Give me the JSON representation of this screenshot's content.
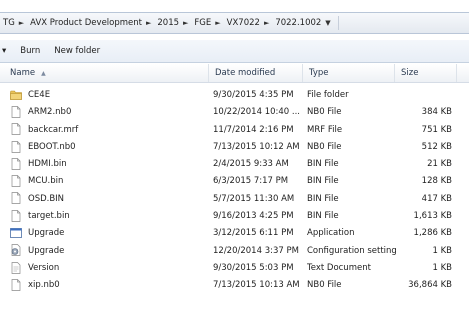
{
  "address": {
    "crumbs": [
      "TG",
      "AVX Product Development",
      "2015",
      "FGE",
      "VX7022",
      "7022.1002"
    ]
  },
  "toolbar": {
    "burn_label": "Burn",
    "new_folder_label": "New folder"
  },
  "columns": {
    "name": "Name",
    "date": "Date modified",
    "type": "Type",
    "size": "Size"
  },
  "files": [
    {
      "name": "CE4E",
      "date": "9/30/2015 4:35 PM",
      "type": "File folder",
      "size": "",
      "icon": "folder-icon"
    },
    {
      "name": "ARM2.nb0",
      "date": "10/22/2014 10:40 ...",
      "type": "NB0 File",
      "size": "384 KB",
      "icon": "file-icon"
    },
    {
      "name": "backcar.mrf",
      "date": "11/7/2014 2:16 PM",
      "type": "MRF File",
      "size": "751 KB",
      "icon": "file-icon"
    },
    {
      "name": "EBOOT.nb0",
      "date": "7/13/2015 10:12 AM",
      "type": "NB0 File",
      "size": "512 KB",
      "icon": "file-icon"
    },
    {
      "name": "HDMI.bin",
      "date": "2/4/2015 9:33 AM",
      "type": "BIN File",
      "size": "21 KB",
      "icon": "file-icon"
    },
    {
      "name": "MCU.bin",
      "date": "6/3/2015 7:17 PM",
      "type": "BIN File",
      "size": "128 KB",
      "icon": "file-icon"
    },
    {
      "name": "OSD.BIN",
      "date": "5/7/2015 11:30 AM",
      "type": "BIN File",
      "size": "417 KB",
      "icon": "file-icon"
    },
    {
      "name": "target.bin",
      "date": "9/16/2013 4:25 PM",
      "type": "BIN File",
      "size": "1,613 KB",
      "icon": "file-icon"
    },
    {
      "name": "Upgrade",
      "date": "3/12/2015 6:11 PM",
      "type": "Application",
      "size": "1,286 KB",
      "icon": "application-icon"
    },
    {
      "name": "Upgrade",
      "date": "12/20/2014 3:37 PM",
      "type": "Configuration settings",
      "size": "1 KB",
      "icon": "settings-file-icon"
    },
    {
      "name": "Version",
      "date": "9/30/2015 5:03 PM",
      "type": "Text Document",
      "size": "1 KB",
      "icon": "text-document-icon"
    },
    {
      "name": "xip.nb0",
      "date": "7/13/2015 10:13 AM",
      "type": "NB0 File",
      "size": "36,864 KB",
      "icon": "file-icon"
    }
  ]
}
